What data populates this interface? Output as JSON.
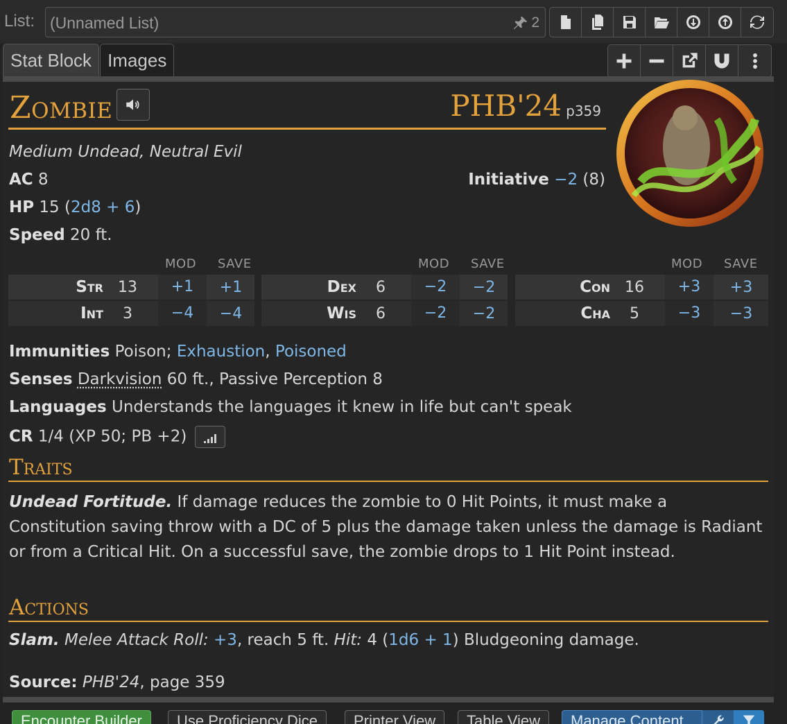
{
  "list_bar": {
    "label": "List:",
    "list_name": "(Unnamed List)",
    "pin_count": "2",
    "buttons": [
      "new-file-icon",
      "copy-file-icon",
      "save-icon",
      "folder-open-icon",
      "download-icon",
      "upload-icon",
      "refresh-icon"
    ]
  },
  "tabs": [
    {
      "label": "Stat Block",
      "active": true
    },
    {
      "label": "Images",
      "active": false
    }
  ],
  "toolbar": [
    "plus-icon",
    "minus-icon",
    "popout-icon",
    "magnet-icon",
    "more-vertical-icon"
  ],
  "creature": {
    "name": "Zombie",
    "source_abbr": "PHB'24",
    "source_page": "p359",
    "type_line": "Medium Undead, Neutral Evil",
    "ac_label": "AC",
    "ac_value": "8",
    "initiative_label": "Initiative",
    "initiative_mod": "−2",
    "initiative_score": "(8)",
    "hp_label": "HP",
    "hp_value": "15 (",
    "hp_dice": "2d8 + 6",
    "hp_close": ")",
    "speed_label": "Speed",
    "speed_value": "20 ft."
  },
  "ability_headers": {
    "mod": "MOD",
    "save": "SAVE"
  },
  "abilities": [
    {
      "name": "Str",
      "score": "13",
      "mod": "+1",
      "save": "+1"
    },
    {
      "name": "Int",
      "score": "3",
      "mod": "−4",
      "save": "−4"
    },
    {
      "name": "Dex",
      "score": "6",
      "mod": "−2",
      "save": "−2"
    },
    {
      "name": "Wis",
      "score": "6",
      "mod": "−2",
      "save": "−2"
    },
    {
      "name": "Con",
      "score": "16",
      "mod": "+3",
      "save": "+3"
    },
    {
      "name": "Cha",
      "score": "5",
      "mod": "−3",
      "save": "−3"
    }
  ],
  "details": {
    "immunities_label": "Immunities",
    "immunities_text": "Poison;",
    "immunity_link_1": "Exhaustion",
    "immunity_sep": ",",
    "immunity_link_2": "Poisoned",
    "senses_label": "Senses",
    "senses_link": "Darkvision",
    "senses_text": "60 ft., Passive Perception 8",
    "languages_label": "Languages",
    "languages_text": "Understands the languages it knew in life but can't speak",
    "cr_label": "CR",
    "cr_text": "1/4 (XP 50; PB +2)"
  },
  "traits": {
    "heading": "Traits",
    "name": "Undead Fortitude.",
    "text": "If damage reduces the zombie to 0 Hit Points, it must make a Constitution saving throw with a DC of 5 plus the damage taken unless the damage is Radiant or from a Critical Hit. On a successful save, the zombie drops to 1 Hit Point instead."
  },
  "actions": {
    "heading": "Actions",
    "name": "Slam.",
    "attack_type": "Melee Attack Roll:",
    "attack_bonus": "+3",
    "reach": ", reach 5 ft.",
    "hit_label": "Hit:",
    "hit_value": "4 (",
    "hit_dice": "1d6 + 1",
    "hit_tail": ") Bludgeoning damage."
  },
  "source_line": {
    "label": "Source:",
    "book": "PHB'24",
    "page": ", page 359"
  },
  "bottom_buttons": [
    "Encounter Builder",
    "Use Proficiency Dice",
    "Printer View",
    "Table View",
    "Manage Content"
  ],
  "colors": {
    "accent": "#e3a23c",
    "link": "#7fb8e8",
    "background": "#232323"
  }
}
